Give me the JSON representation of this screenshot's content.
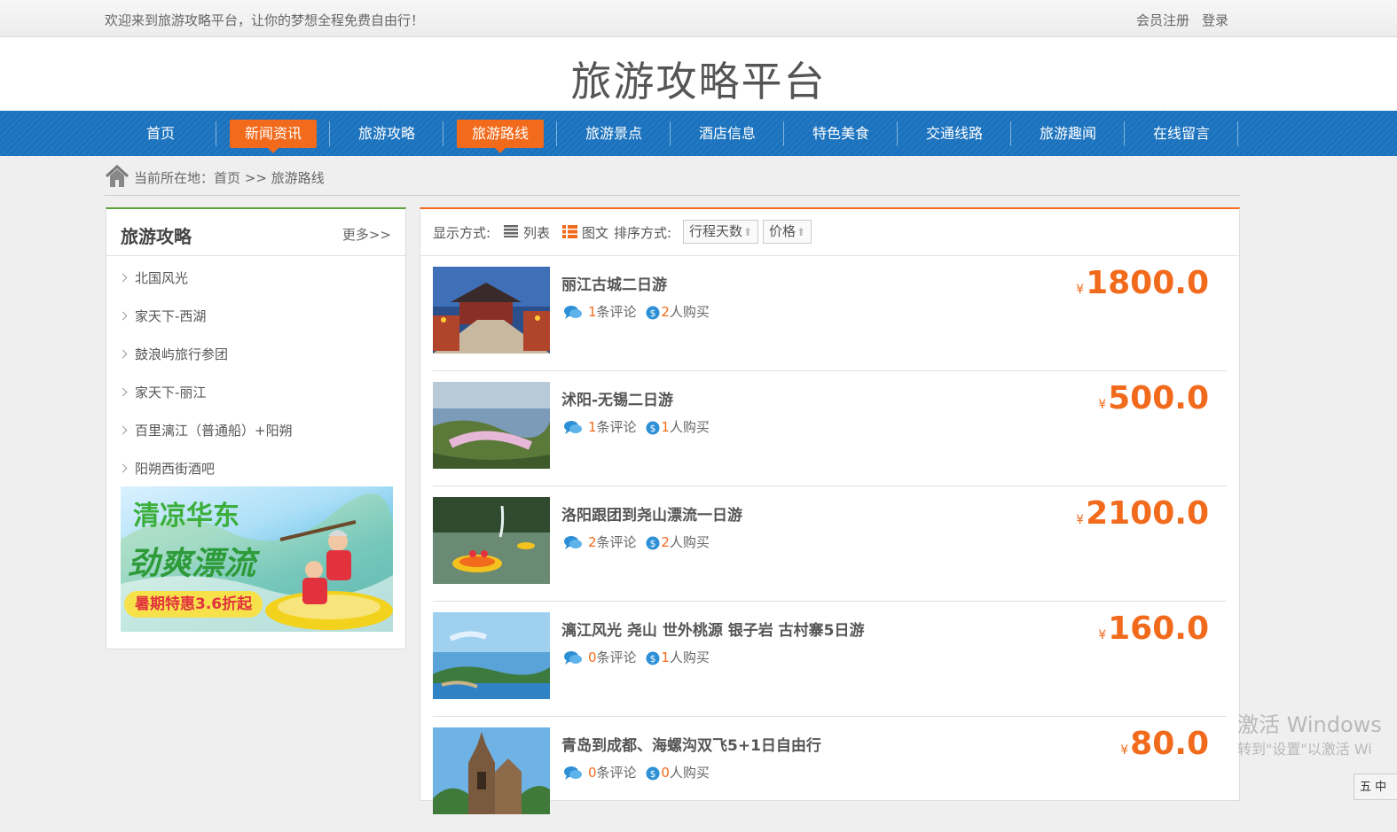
{
  "topbar": {
    "welcome": "欢迎来到旅游攻略平台，让你的梦想全程免费自由行！",
    "register": "会员注册",
    "login": "登录"
  },
  "header": {
    "title": "旅游攻略平台"
  },
  "nav": {
    "items": [
      {
        "label": "首页",
        "active": false
      },
      {
        "label": "新闻资讯",
        "active": true
      },
      {
        "label": "旅游攻略",
        "active": false
      },
      {
        "label": "旅游路线",
        "active": true
      },
      {
        "label": "旅游景点",
        "active": false
      },
      {
        "label": "酒店信息",
        "active": false
      },
      {
        "label": "特色美食",
        "active": false
      },
      {
        "label": "交通线路",
        "active": false
      },
      {
        "label": "旅游趣闻",
        "active": false
      },
      {
        "label": "在线留言",
        "active": false
      }
    ]
  },
  "breadcrumb": {
    "text": "当前所在地：首页 >> 旅游路线"
  },
  "sidebar": {
    "title": "旅游攻略",
    "more": "更多>>",
    "items": [
      {
        "label": "北国风光"
      },
      {
        "label": "家天下-西湖"
      },
      {
        "label": "鼓浪屿旅行参团"
      },
      {
        "label": "家天下-丽江"
      },
      {
        "label": "百里漓江（普通船）+阳朔"
      },
      {
        "label": "阳朔西街酒吧"
      }
    ],
    "banner": {
      "line1": "清凉华东",
      "line2": "劲爽漂流",
      "promo": "暑期特惠3.6折起"
    }
  },
  "toolbar": {
    "display_label": "显示方式:",
    "list_label": "列表",
    "grid_label": "图文",
    "sort_label": "排序方式:",
    "sort_days": "行程天数",
    "sort_price": "价格",
    "arrow": "⬆"
  },
  "routes": [
    {
      "title": "丽江古城二日游",
      "comments": "1",
      "comments_suffix": "条评论",
      "buyers": "2",
      "buyers_suffix": "人购买",
      "price": "1800.0",
      "yen": "¥"
    },
    {
      "title": "沭阳-无锡二日游",
      "comments": "1",
      "comments_suffix": "条评论",
      "buyers": "1",
      "buyers_suffix": "人购买",
      "price": "500.0",
      "yen": "¥"
    },
    {
      "title": "洛阳跟团到尧山漂流一日游",
      "comments": "2",
      "comments_suffix": "条评论",
      "buyers": "2",
      "buyers_suffix": "人购买",
      "price": "2100.0",
      "yen": "¥"
    },
    {
      "title": "漓江风光 尧山 世外桃源 银子岩 古村寨5日游",
      "comments": "0",
      "comments_suffix": "条评论",
      "buyers": "1",
      "buyers_suffix": "人购买",
      "price": "160.0",
      "yen": "¥"
    },
    {
      "title": "青岛到成都、海螺沟双飞5+1日自由行",
      "comments": "0",
      "comments_suffix": "条评论",
      "buyers": "0",
      "buyers_suffix": "人购买",
      "price": "80.0",
      "yen": "¥"
    }
  ],
  "watermark": {
    "line1": "激活 Windows",
    "line2": "转到\"设置\"以激活 Wi"
  },
  "ime": {
    "label": "五 中"
  },
  "colors": {
    "nav_blue": "#1a72be",
    "accent_orange": "#f26a1b",
    "sidebar_green": "#5aa23a"
  }
}
